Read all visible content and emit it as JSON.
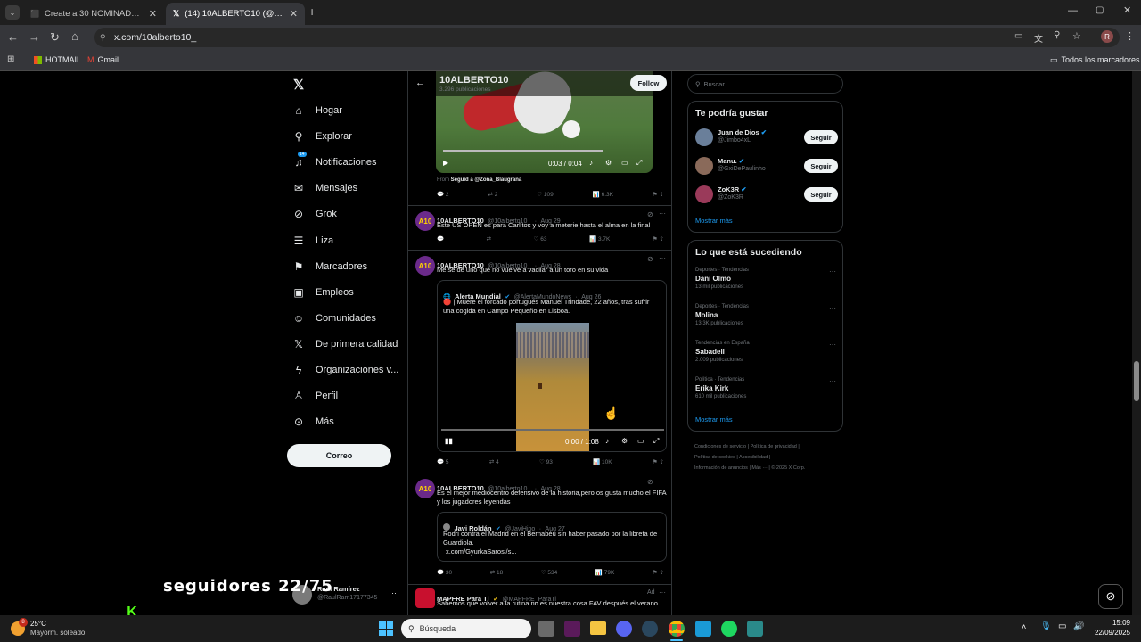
{
  "browser": {
    "tabs": [
      {
        "title": "Create a 30 NOMINADOS BALÓ",
        "close": "✕"
      },
      {
        "title": "(14) 10ALBERTO10 (@10albertc",
        "close": "✕"
      }
    ],
    "new_tab": "+",
    "url": "x.com/10alberto10_",
    "bookmarks": [
      {
        "label": "HOTMAIL"
      },
      {
        "label": "Gmail"
      }
    ],
    "all_bookmarks": "Todos los marcadores",
    "profile_letter": "R"
  },
  "nav": {
    "items": [
      {
        "label": "Hogar",
        "icon": "home-icon"
      },
      {
        "label": "Explorar",
        "icon": "search-icon"
      },
      {
        "label": "Notificaciones",
        "icon": "bell-icon",
        "badge": "14"
      },
      {
        "label": "Mensajes",
        "icon": "mail-icon"
      },
      {
        "label": "Grok",
        "icon": "grok-icon"
      },
      {
        "label": "Liza",
        "icon": "list-icon"
      },
      {
        "label": "Marcadores",
        "icon": "bookmark-icon"
      },
      {
        "label": "Empleos",
        "icon": "briefcase-icon"
      },
      {
        "label": "Comunidades",
        "icon": "people-icon"
      },
      {
        "label": "De primera calidad",
        "icon": "x-logo-icon"
      },
      {
        "label": "Organizaciones v...",
        "icon": "lightning-icon"
      },
      {
        "label": "Perfil",
        "icon": "person-icon"
      },
      {
        "label": "Más",
        "icon": "more-icon"
      }
    ],
    "post_button": "Correo",
    "account": {
      "name": "Raúl Ramírez",
      "handle": "@RaulRam17177345"
    }
  },
  "overlay": {
    "text": "seguidores 22/75"
  },
  "header": {
    "name": "10ALBERTO10",
    "count": "3.296 publicaciones",
    "follow": "Follow"
  },
  "video1": {
    "time": "0:03 / 0:04",
    "from_label": "From",
    "from": "Seguid a @Zona_Blaugrana",
    "stats": {
      "replies": "2",
      "reposts": "2",
      "likes": "109",
      "views": "6.3K"
    }
  },
  "tweets": [
    {
      "name": "10ALBERTO10",
      "handle": "@10alberto10_",
      "date": "Aug 29",
      "text": "Este US OPEN es para Carlitos y voy a meterie hasta el alma en la final",
      "stats": {
        "replies": "",
        "reposts": "",
        "likes": "63",
        "views": "3.7K"
      }
    },
    {
      "name": "10ALBERTO10",
      "handle": "@10alberto10_",
      "date": "Aug 28",
      "text": "Me sé de uno que no vuelve a vacilar a un toro en su vida",
      "quote": {
        "name": "Alerta Mundial",
        "handle": "@AlertaMundoNews",
        "date": "Aug 26",
        "text": "🔴 | Muere el forcado portugués Manuel Trindade, 22 años, tras sufrir una cogida en Campo Pequeño en Lisboa.",
        "time": "0:00 / 1:08"
      },
      "stats": {
        "replies": "5",
        "reposts": "4",
        "likes": "93",
        "views": "10K"
      }
    },
    {
      "name": "10ALBERTO10",
      "handle": "@10alberto10_",
      "date": "Aug 28",
      "text": "Es el mejor mediocentro defensivo de la historia,pero os gusta mucho el FIFA y los jugadores leyendas",
      "quote": {
        "name": "Javi Roldán",
        "handle": "@JaviHipo",
        "date": "Aug 27",
        "text": "Rodri contra el Madrid en el Bernabéu sin haber pasado por la libreta de Guardiola.",
        "link": "x.com/GyurkaSarosi/s..."
      },
      "stats": {
        "replies": "30",
        "reposts": "18",
        "likes": "534",
        "views": "79K"
      }
    },
    {
      "name": "MAPFRE Para Ti",
      "handle": "@MAPFRE_ParaTi",
      "date": "Ad",
      "text": "Sabemos que volver a la rutina no es nuestra cosa FAV después el verano"
    }
  ],
  "search": {
    "placeholder": "Buscar"
  },
  "suggest": {
    "title": "Te podría gustar",
    "users": [
      {
        "name": "Juan de Dios",
        "handle": "@Jimbo4xL",
        "btn": "Seguir"
      },
      {
        "name": "Manu.",
        "handle": "@GxiDePaulinho",
        "btn": "Seguir"
      },
      {
        "name": "ZoK3R",
        "handle": "@ZoK3R",
        "btn": "Seguir"
      }
    ],
    "more": "Mostrar más"
  },
  "trends": {
    "title": "Lo que está sucediendo",
    "items": [
      {
        "cat": "Deportes · Tendencias",
        "name": "Dani Olmo",
        "posts": "13 mil publicaciones"
      },
      {
        "cat": "Deportes · Tendencias",
        "name": "Molina",
        "posts": "13.3K publicaciones"
      },
      {
        "cat": "Tendencias en España",
        "name": "Sabadell",
        "posts": "2.009 publicaciones"
      },
      {
        "cat": "Política · Tendencias",
        "name": "Erika Kirk",
        "posts": "610 mil publicaciones"
      }
    ],
    "more": "Mostrar más"
  },
  "footer": {
    "line1": "Condiciones de servicio  |  Política de privacidad  |",
    "line2": "Política de cookies  |  Accesibilidad  |",
    "line3": "Información de anuncios  |  Más ···  |  © 2025 X Corp."
  },
  "taskbar": {
    "weather_temp": "25°C",
    "weather_desc": "Mayorm. soleado",
    "search": "Búsqueda",
    "time": "15:09",
    "date": "22/09/2025",
    "weather_badge": "8"
  }
}
